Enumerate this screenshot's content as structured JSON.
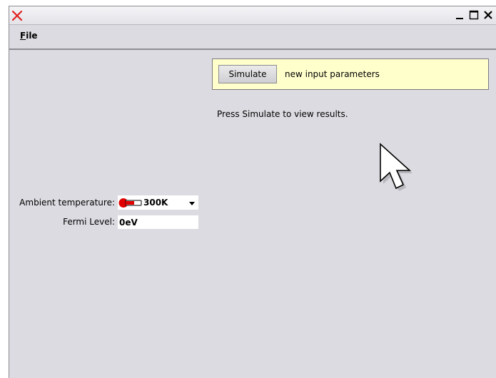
{
  "window": {
    "title": "",
    "icons": {
      "app": "x-logo-icon",
      "minimize": "minimize-icon",
      "maximize": "maximize-icon",
      "close": "close-icon"
    }
  },
  "menubar": {
    "file_mnemonic": "F",
    "file_rest": "ile"
  },
  "simulate_panel": {
    "button_label": "Simulate",
    "status_text": "new input parameters",
    "background_color": "#ffffcc"
  },
  "results": {
    "hint_text": "Press Simulate to view results."
  },
  "controls": {
    "temperature": {
      "label": "Ambient temperature:",
      "value": "300K",
      "icon": "thermometer-icon",
      "icon_color": "#e00000"
    },
    "fermi": {
      "label": "Fermi Level:",
      "value": "0eV"
    }
  },
  "pointer": {
    "icon": "mouse-pointer-icon"
  }
}
